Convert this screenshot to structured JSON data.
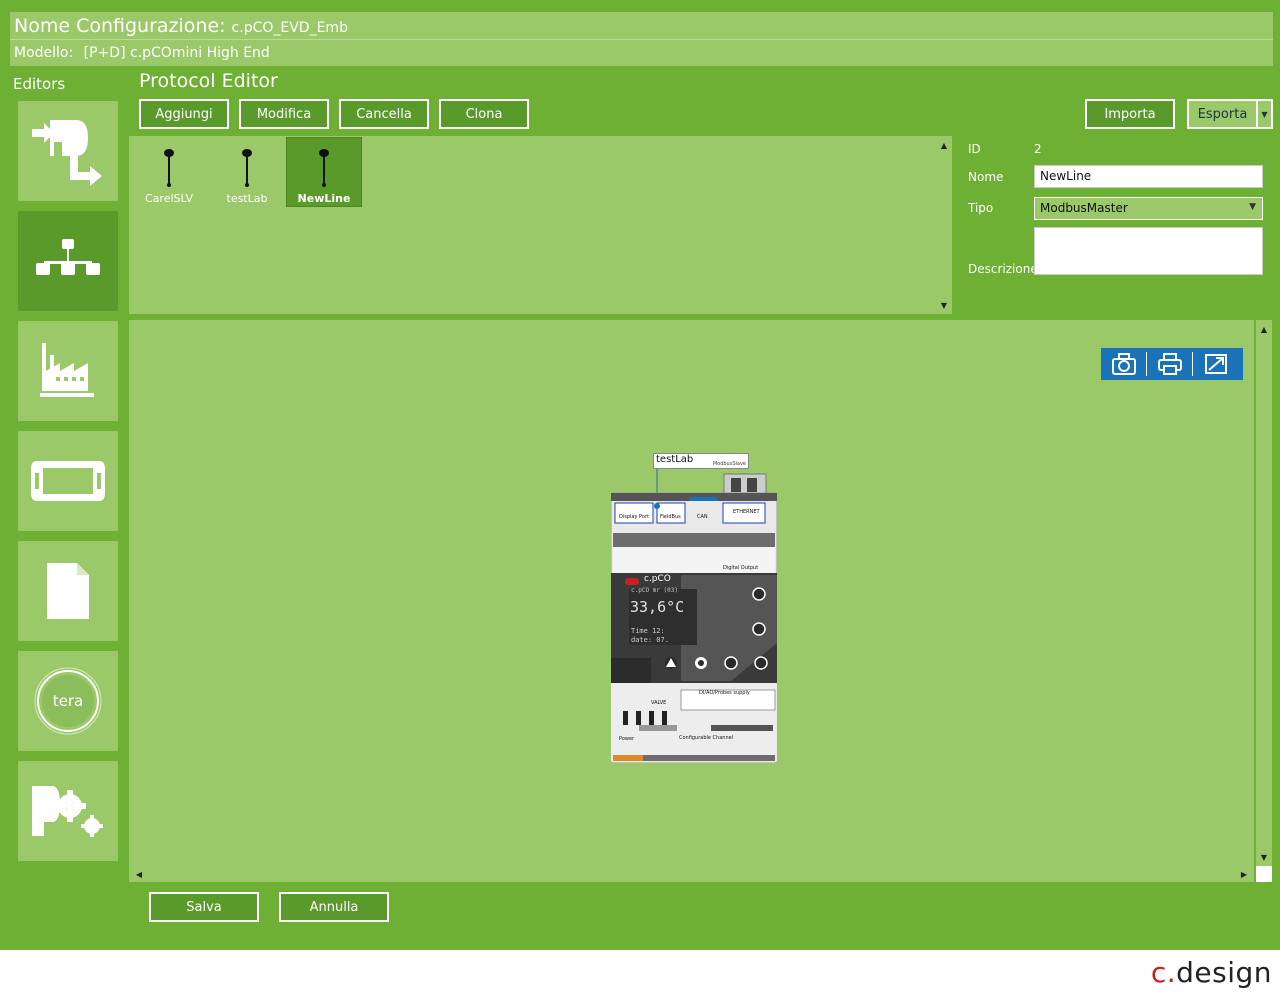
{
  "header": {
    "config_label": "Nome Configurazione:",
    "config_value": "c.pCO_EVD_Emb",
    "model_label": "Modello:",
    "model_value": "[P+D] c.pCOmini High End"
  },
  "sidebar": {
    "title": "Editors",
    "items": [
      {
        "name": "io-editor",
        "icon": "flow-arrows-icon"
      },
      {
        "name": "protocol-editor",
        "icon": "network-tree-icon",
        "active": true
      },
      {
        "name": "plant-editor",
        "icon": "factory-icon"
      },
      {
        "name": "terminal-editor",
        "icon": "display-terminal-icon"
      },
      {
        "name": "document-editor",
        "icon": "document-icon"
      },
      {
        "name": "tera-editor",
        "icon": "tera-logo-icon",
        "text": "tera"
      },
      {
        "name": "settings-editor",
        "icon": "gears-icon"
      }
    ]
  },
  "editor": {
    "title": "Protocol Editor",
    "toolbar": {
      "add": "Aggiungi",
      "modify": "Modifica",
      "delete": "Cancella",
      "clone": "Clona",
      "import": "Importa",
      "export": "Esporta"
    },
    "protocols": [
      {
        "label": "CarelSLV"
      },
      {
        "label": "testLab"
      },
      {
        "label": "NewLine",
        "selected": true
      }
    ]
  },
  "properties": {
    "id_label": "ID",
    "id_value": "2",
    "name_label": "Nome",
    "name_value": "NewLine",
    "type_label": "Tipo",
    "type_value": "ModbusMaster",
    "description_label": "Descrizione",
    "description_value": ""
  },
  "canvas": {
    "node_label": "testLab",
    "node_sublabel": "ModbusSlave",
    "device": {
      "brand": "c.pCO",
      "screen_line1": "c.pCO mr (03)",
      "screen_temp": "33,6°C",
      "screen_time": "Time 12:",
      "screen_date": "date: 07.",
      "display_port": "Display Port",
      "fieldbus": "FieldBus",
      "can": "CAN",
      "ethernet": "ETHERNET",
      "digital_output": "Digital Output",
      "valve": "VALVE",
      "probes_supply": "DI/AO/Probes supply",
      "power": "Power",
      "configurable_channel": "Configurable Channel"
    }
  },
  "actions": {
    "save": "Salva",
    "cancel": "Annulla"
  },
  "footer": {
    "logo_c": "c.",
    "logo_rest": "design"
  },
  "colors": {
    "background": "#6db033",
    "panel": "#9bc969",
    "active": "#5a9a2b",
    "tools": "#1a72b8",
    "logo_red": "#c8201e"
  }
}
